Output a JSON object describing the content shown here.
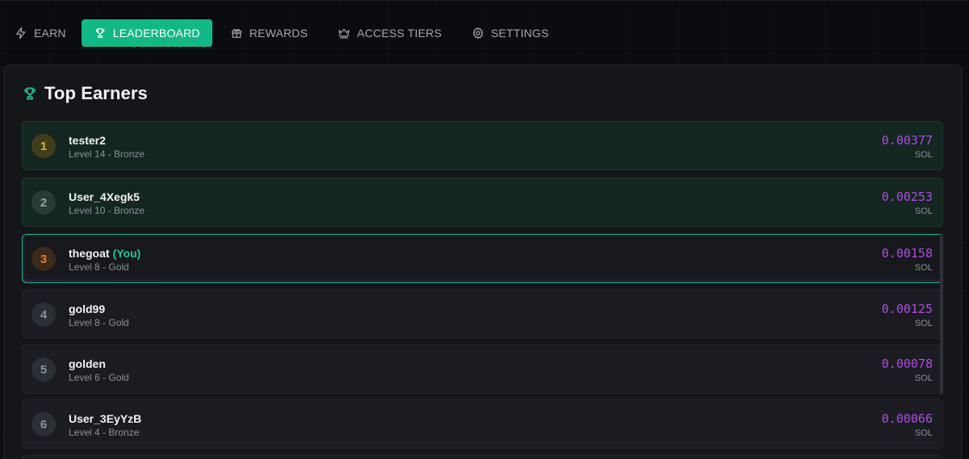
{
  "nav": {
    "tabs": [
      {
        "label": "EARN",
        "icon": "lightning-icon"
      },
      {
        "label": "LEADERBOARD",
        "icon": "trophy-icon",
        "active": true
      },
      {
        "label": "REWARDS",
        "icon": "gift-icon"
      },
      {
        "label": "ACCESS TIERS",
        "icon": "crown-icon"
      },
      {
        "label": "SETTINGS",
        "icon": "gear-icon"
      }
    ]
  },
  "leaderboard": {
    "title": "Top Earners",
    "icon": "trophy-icon",
    "rows": [
      {
        "rank": "1",
        "name": "tester2",
        "level": "Level 14 - Bronze",
        "amount": "0.00377",
        "unit": "SOL"
      },
      {
        "rank": "2",
        "name": "User_4Xegk5",
        "level": "Level 10 - Bronze",
        "amount": "0.00253",
        "unit": "SOL"
      },
      {
        "rank": "3",
        "name": "thegoat",
        "you": "(You)",
        "level": "Level 8 - Gold",
        "amount": "0.00158",
        "unit": "SOL"
      },
      {
        "rank": "4",
        "name": "gold99",
        "level": "Level 8 - Gold",
        "amount": "0.00125",
        "unit": "SOL"
      },
      {
        "rank": "5",
        "name": "golden",
        "level": "Level 6 - Gold",
        "amount": "0.00078",
        "unit": "SOL"
      },
      {
        "rank": "6",
        "name": "User_3EyYzB",
        "level": "Level 4 - Bronze",
        "amount": "0.00066",
        "unit": "SOL"
      }
    ]
  },
  "colors": {
    "accent": "#12b886",
    "amount": "#b14ae6",
    "background": "#0b0c0f",
    "panel": "#15161a"
  }
}
